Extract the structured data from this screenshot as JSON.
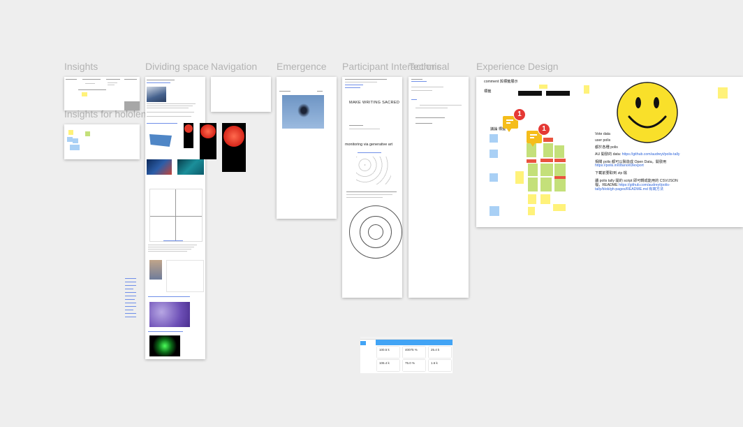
{
  "frames": {
    "insights": "Insights",
    "insights_hololens": "Insights for hololens",
    "dividing_space": "Dividing space",
    "navigation": "Navigation",
    "emergence": "Emergence",
    "participant_interactions": "Participant Interactions",
    "technical": "Technical",
    "experience_design": "Experience Design"
  },
  "emergence_doc": {
    "heading": "MAKE WRITING SACRED",
    "subheading": "monitoring via generative art"
  },
  "experience_doc": {
    "top_label": "comment 與標籤展示",
    "side_label": "標籤",
    "left_label": "議論 標籤",
    "badge_count_1": "1",
    "badge_count_2": "1",
    "info_lines": [
      "Vote data",
      "user polis",
      "都於各種 polis",
      "AU 開發的 data:",
      "相關 polis 都可以製造成 Open Data。開發用",
      "下載前要取到 zip 檔",
      "讀 polis tally 開的 script 即可轉成能用的 CSV/JSON",
      "檔，README"
    ],
    "links": [
      "https://github.com/audreyt/polis-tally",
      "https://polis.in/08anoriDlexport",
      "https://github.com/audreyt/polis-",
      "tally/blob/gh-pages/README.md 有寫方法"
    ]
  },
  "dashboard": {
    "stats": [
      "100.5 k",
      "40075 %",
      "25.4 k",
      "106.4 k",
      "75.0 %",
      "1.6 k"
    ]
  },
  "colors": {
    "sticky_yellow": "#fff27a",
    "sticky_blue": "#a9d0f5",
    "sticky_green": "#c4e07a",
    "sticky_red": "#e9533f",
    "comment_orange": "#f5bd1b",
    "badge_red": "#e53935",
    "smiley_yellow": "#f9e02a",
    "dashboard_blue": "#42a4f5"
  },
  "icons": [
    "smiley-face-icon",
    "comment-icon",
    "notification-badge"
  ]
}
